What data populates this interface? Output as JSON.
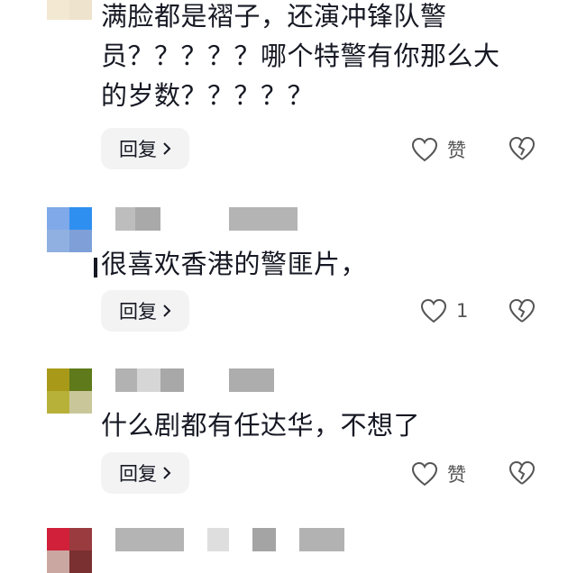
{
  "comments": [
    {
      "text": "满脸都是褶子，还演冲锋队警\n员？？？？？哪个特警有你那么大\n的岁数？？？？？",
      "reply_label": "回复",
      "like_label": "赞",
      "avatar_colors": [
        "#f3e8d2",
        "#f3e8d2",
        "#ffffff",
        "#ffffff"
      ]
    },
    {
      "text": "很喜欢香港的警匪片，",
      "reply_label": "回复",
      "like_label": "1",
      "avatar_colors": [
        "#7fa9e8",
        "#2f8ff0",
        "#8fb0e0",
        "#7f9fd8"
      ]
    },
    {
      "text": "什么剧都有任达华，不想了",
      "reply_label": "回复",
      "like_label": "赞",
      "avatar_colors": [
        "#a89a18",
        "#5e7a1a",
        "#b7b13a",
        "#c9c79a"
      ]
    },
    {
      "avatar_colors": [
        "#d0203a",
        "#9a3b3f",
        "#caa7a1",
        "#7a3030"
      ]
    }
  ],
  "colors": {
    "text": "#161823",
    "reply_bg": "#f3f3f4",
    "icon": "#555555",
    "name_blur": "#b8b8b8"
  },
  "icons": {
    "like": "heart-outline-icon",
    "dislike": "broken-heart-icon",
    "reply_arrow": "chevron-right-icon"
  }
}
